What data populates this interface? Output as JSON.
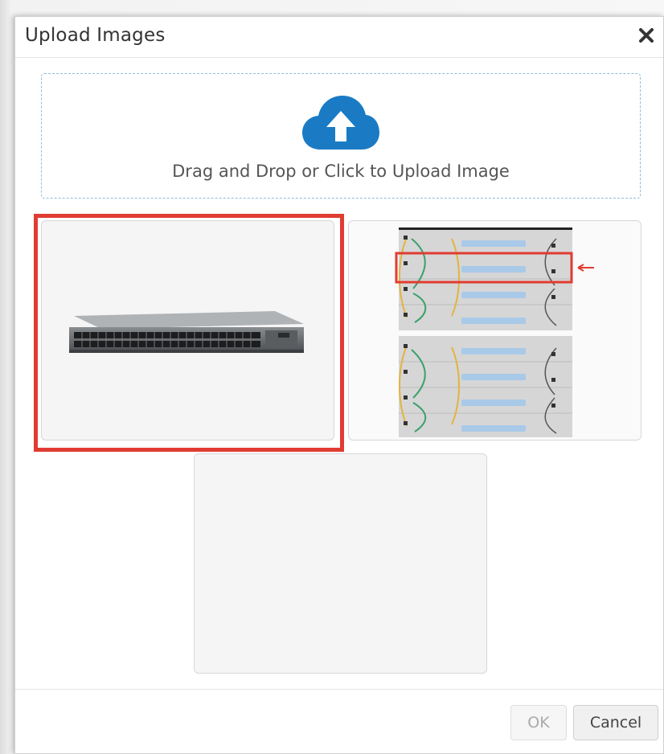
{
  "dialog": {
    "title": "Upload Images"
  },
  "dropzone": {
    "text": "Drag and Drop or Click to Upload Image"
  },
  "images": [
    {
      "name": "switch-photo",
      "selected": true
    },
    {
      "name": "rack-cabling-diagram",
      "selected": false
    },
    {
      "name": "empty-slot",
      "selected": false
    }
  ],
  "buttons": {
    "ok_label": "OK",
    "cancel_label": "Cancel"
  },
  "colors": {
    "accent": "#1a7bc4",
    "selection": "#e03c31"
  },
  "icons": {
    "close": "close-icon",
    "upload": "cloud-upload-icon"
  }
}
